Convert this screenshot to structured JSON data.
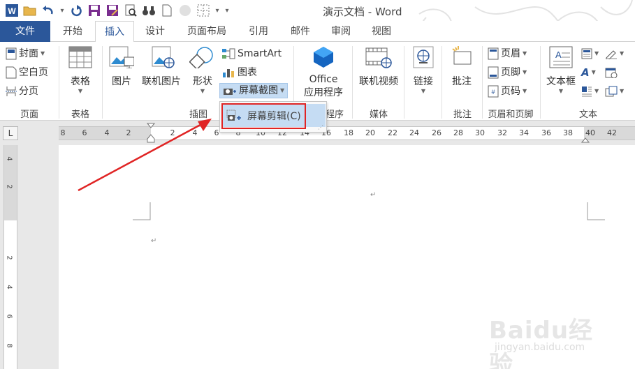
{
  "window": {
    "title": "演示文档 - Word"
  },
  "tabs": [
    {
      "label": "文件"
    },
    {
      "label": "开始"
    },
    {
      "label": "插入"
    },
    {
      "label": "设计"
    },
    {
      "label": "页面布局"
    },
    {
      "label": "引用"
    },
    {
      "label": "邮件"
    },
    {
      "label": "审阅"
    },
    {
      "label": "视图"
    }
  ],
  "ribbon": {
    "pages": {
      "cover": "封面",
      "blank": "空白页",
      "break": "分页",
      "label": "页面"
    },
    "tables": {
      "table": "表格",
      "label": "表格"
    },
    "illustrations": {
      "picture": "图片",
      "online_picture": "联机图片",
      "shapes": "形状",
      "smartart": "SmartArt",
      "chart": "图表",
      "screenshot": "屏幕截图",
      "label": "插图"
    },
    "apps": {
      "office_line1": "Office",
      "office_line2": "应用程序",
      "label": "程序"
    },
    "media": {
      "online_video": "联机视频",
      "label": "媒体"
    },
    "links": {
      "link": "链接"
    },
    "comments": {
      "comment": "批注",
      "label": "批注"
    },
    "header_footer": {
      "header": "页眉",
      "footer": "页脚",
      "page_number": "页码",
      "label": "页眉和页脚"
    },
    "text": {
      "textbox": "文本框",
      "label": "文本"
    }
  },
  "dropdown": {
    "item": "屏幕剪辑(C)"
  },
  "ruler": {
    "h_ticks": [
      "8",
      "6",
      "4",
      "2",
      "2",
      "4",
      "6",
      "8",
      "10",
      "12",
      "14",
      "16",
      "18",
      "20",
      "22",
      "24",
      "26",
      "28",
      "30",
      "32",
      "34",
      "36",
      "38",
      "40",
      "42"
    ],
    "v_ticks": [
      "4",
      "2",
      "2",
      "4",
      "6",
      "8"
    ]
  },
  "watermark": {
    "main": "Baidu经验",
    "sub": "jingyan.baidu.com"
  },
  "colors": {
    "accent": "#2b579a",
    "highlight": "#e02424",
    "menu_hover": "#c5dcf3"
  }
}
